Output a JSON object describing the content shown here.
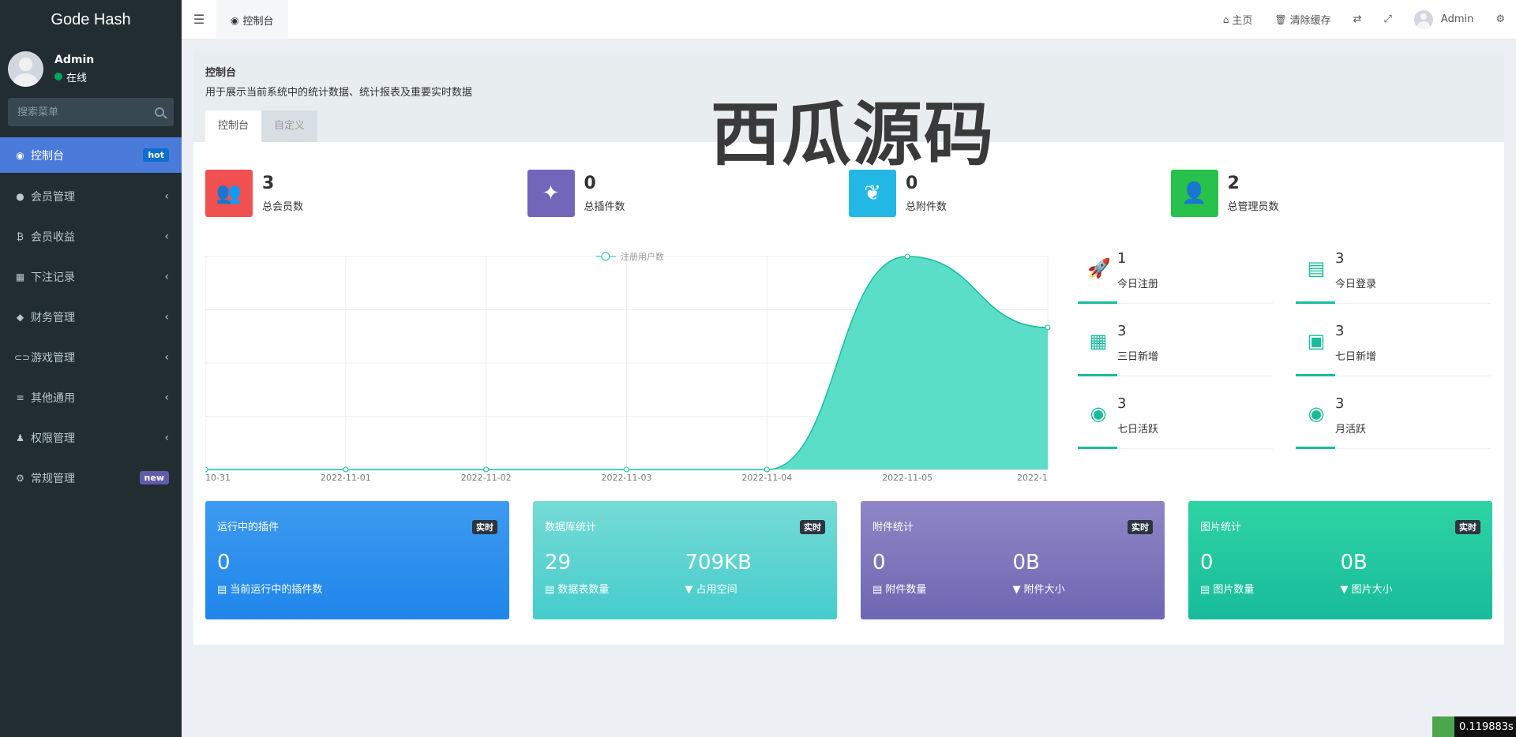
{
  "app": {
    "logo": "Gode Hash"
  },
  "user": {
    "name": "Admin",
    "status": "在线"
  },
  "search": {
    "placeholder": "搜索菜单"
  },
  "menu": [
    {
      "label": "控制台",
      "badge": "hot",
      "icon": "dashboard-icon",
      "glyph": "◉"
    },
    {
      "label": "会员管理",
      "icon": "user-circle-icon",
      "glyph": "●"
    },
    {
      "label": "会员收益",
      "icon": "bitcoin-icon",
      "glyph": "₿"
    },
    {
      "label": "下注记录",
      "icon": "calendar-icon",
      "glyph": "▦"
    },
    {
      "label": "财务管理",
      "icon": "diamond-icon",
      "glyph": "◆"
    },
    {
      "label": "游戏管理",
      "icon": "gamepad-icon",
      "glyph": "⊂⊃"
    },
    {
      "label": "其他通用",
      "icon": "list-icon",
      "glyph": "≡"
    },
    {
      "label": "权限管理",
      "icon": "users-icon",
      "glyph": "♟"
    },
    {
      "label": "常规管理",
      "badge": "new",
      "icon": "cogs-icon",
      "glyph": "⚙"
    }
  ],
  "topnav": {
    "tab": "控制台",
    "home": "主页",
    "clear_cache": "清除缓存",
    "admin": "Admin"
  },
  "panel": {
    "title": "控制台",
    "desc": "用于展示当前系统中的统计数据、统计报表及重要实时数据",
    "tabs": [
      "控制台",
      "自定义"
    ]
  },
  "stats": [
    {
      "value": "3",
      "label": "总会员数",
      "color": "#f05050",
      "icon": "users-icon"
    },
    {
      "value": "0",
      "label": "总插件数",
      "color": "#7266ba",
      "icon": "magic-icon"
    },
    {
      "value": "0",
      "label": "总附件数",
      "color": "#23b7e5",
      "icon": "leaf-icon"
    },
    {
      "value": "2",
      "label": "总管理员数",
      "color": "#27c24c",
      "icon": "user-icon"
    }
  ],
  "mini_stats": [
    {
      "value": "1",
      "label": "今日注册",
      "icon": "rocket-icon"
    },
    {
      "value": "3",
      "label": "今日登录",
      "icon": "vcard-icon"
    },
    {
      "value": "3",
      "label": "三日新增",
      "icon": "calendar-icon"
    },
    {
      "value": "3",
      "label": "七日新增",
      "icon": "calendar-plus-icon"
    },
    {
      "value": "3",
      "label": "七日活跃",
      "icon": "user-circle-icon"
    },
    {
      "value": "3",
      "label": "月活跃",
      "icon": "user-circle-icon"
    }
  ],
  "chart_data": {
    "type": "area",
    "series": [
      {
        "name": "注册用户数",
        "values": [
          0,
          0,
          0,
          0,
          0,
          3,
          2
        ]
      }
    ],
    "x": [
      "10-31",
      "2022-11-01",
      "2022-11-02",
      "2022-11-03",
      "2022-11-04",
      "2022-11-05",
      "2022-1"
    ],
    "color": "#18bc9c",
    "grid": true
  },
  "cards": [
    {
      "title": "运行中的插件",
      "badge": "实时",
      "cols": [
        {
          "num": "0",
          "sub": "当前运行中的插件数"
        }
      ]
    },
    {
      "title": "数据库统计",
      "badge": "实时",
      "cols": [
        {
          "num": "29",
          "sub": "数据表数量"
        },
        {
          "num": "709KB",
          "sub": "占用空间"
        }
      ]
    },
    {
      "title": "附件统计",
      "badge": "实时",
      "cols": [
        {
          "num": "0",
          "sub": "附件数量"
        },
        {
          "num": "0B",
          "sub": "附件大小"
        }
      ]
    },
    {
      "title": "图片统计",
      "badge": "实时",
      "cols": [
        {
          "num": "0",
          "sub": "图片数量"
        },
        {
          "num": "0B",
          "sub": "图片大小"
        }
      ]
    }
  ],
  "watermark": "西瓜源码",
  "timer": "0.119883s"
}
